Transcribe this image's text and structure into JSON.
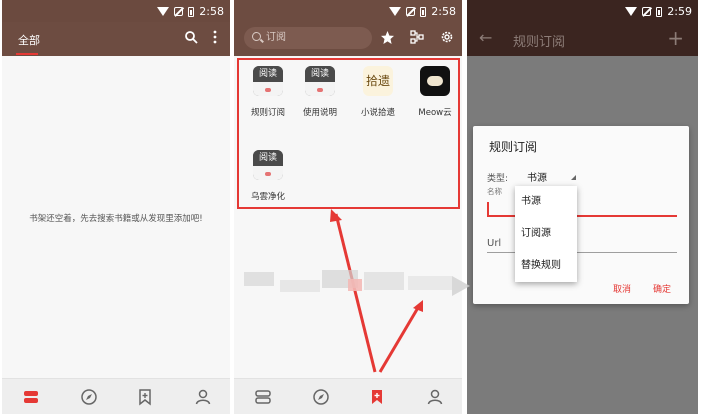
{
  "panel1": {
    "status_time": "2:58",
    "tab_all": "全部",
    "empty_message": "书架还空着，先去搜索书籍或从发现里添加吧!"
  },
  "panel2": {
    "status_time": "2:58",
    "search_placeholder": "订阅",
    "tiles": [
      {
        "label": "规则订阅",
        "icon": "yuedu-app-icon",
        "icon_text": "阅读"
      },
      {
        "label": "使用说明",
        "icon": "yuedu-app-icon",
        "icon_text": "阅读"
      },
      {
        "label": "小说拾遗",
        "icon": "novel-calligraphy-icon",
        "icon_text": "拾遗"
      },
      {
        "label": "Meow云",
        "icon": "meow-cloud-icon",
        "icon_text": ""
      },
      {
        "label": "乌雲净化",
        "icon": "yuedu-app-icon",
        "icon_text": "阅读"
      }
    ]
  },
  "panel3": {
    "status_time": "2:59",
    "title": "规则订阅",
    "dialog": {
      "title": "规则订阅",
      "type_label": "类型:",
      "type_value": "书源",
      "name_label": "名称",
      "url_label": "Url",
      "cancel": "取消",
      "confirm": "确定"
    },
    "dropdown_options": [
      "书源",
      "订阅源",
      "替换规则"
    ]
  },
  "colors": {
    "appbar_brown": "#6d4c41",
    "appbar_dark": "#3b2520",
    "accent_red": "#e53935"
  }
}
